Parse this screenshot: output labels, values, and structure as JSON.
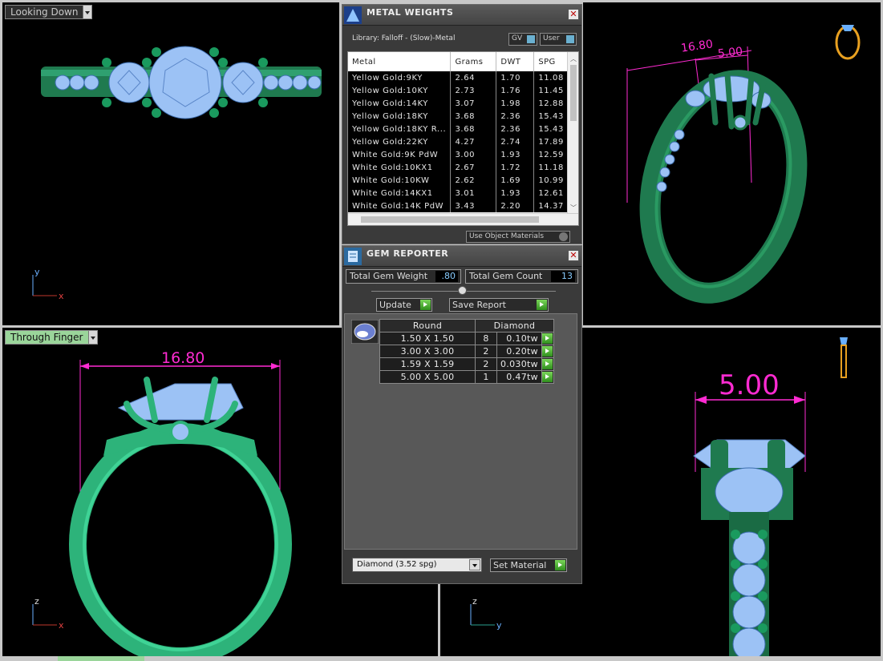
{
  "viewports": {
    "top_left": {
      "label": "Looking Down",
      "axis": {
        "up": "y",
        "right": "x"
      }
    },
    "bottom_left": {
      "label": "Through Finger",
      "dimension": "16.80",
      "axis": {
        "up": "z",
        "right": "x"
      }
    },
    "top_right": {
      "dimension_outer": "16.80",
      "dimension_inner": "5.00"
    },
    "bottom_right": {
      "dimension": "5.00",
      "axis": {
        "up": "z",
        "right": "y"
      }
    }
  },
  "metal_weights": {
    "title": "METAL WEIGHTS",
    "library_label": "Library: Falloff - (Slow)-Metal",
    "gv_label": "GV",
    "user_label": "User",
    "columns": [
      "Metal",
      "Grams",
      "DWT",
      "SPG"
    ],
    "rows": [
      [
        "Yellow Gold:9KY",
        "2.64",
        "1.70",
        "11.08"
      ],
      [
        "Yellow Gold:10KY",
        "2.73",
        "1.76",
        "11.45"
      ],
      [
        "Yellow Gold:14KY",
        "3.07",
        "1.98",
        "12.88"
      ],
      [
        "Yellow Gold:18KY",
        "3.68",
        "2.36",
        "15.43"
      ],
      [
        "Yellow Gold:18KY R...",
        "3.68",
        "2.36",
        "15.43"
      ],
      [
        "Yellow Gold:22KY",
        "4.27",
        "2.74",
        "17.89"
      ],
      [
        "White Gold:9K PdW",
        "3.00",
        "1.93",
        "12.59"
      ],
      [
        "White Gold:10KX1",
        "2.67",
        "1.72",
        "11.18"
      ],
      [
        "White Gold:10KW",
        "2.62",
        "1.69",
        "10.99"
      ],
      [
        "White Gold:14KX1",
        "3.01",
        "1.93",
        "12.61"
      ],
      [
        "White Gold:14K PdW",
        "3.43",
        "2.20",
        "14.37"
      ]
    ],
    "use_object_materials": "Use Object Materials"
  },
  "gem_reporter": {
    "title": "GEM REPORTER",
    "total_weight_label": "Total Gem Weight",
    "total_weight_value": ".80",
    "total_count_label": "Total Gem Count",
    "total_count_value": "13",
    "update_label": "Update",
    "save_report_label": "Save Report",
    "shape_header": "Round",
    "material_header": "Diamond",
    "rows": [
      [
        "1.50 X 1.50",
        "8",
        "0.10tw"
      ],
      [
        "3.00 X 3.00",
        "2",
        "0.20tw"
      ],
      [
        "1.59 X 1.59",
        "2",
        "0.030tw"
      ],
      [
        "5.00 X 5.00",
        "1",
        "0.47tw"
      ]
    ],
    "material_select": "Diamond      (3.52 spg)",
    "set_material_label": "Set Material"
  },
  "colors": {
    "metal_green": "#1f7a4f",
    "gem_blue": "#9cc2f5",
    "dimension_magenta": "#ff2bd2",
    "viewport_bg": "#000000"
  }
}
